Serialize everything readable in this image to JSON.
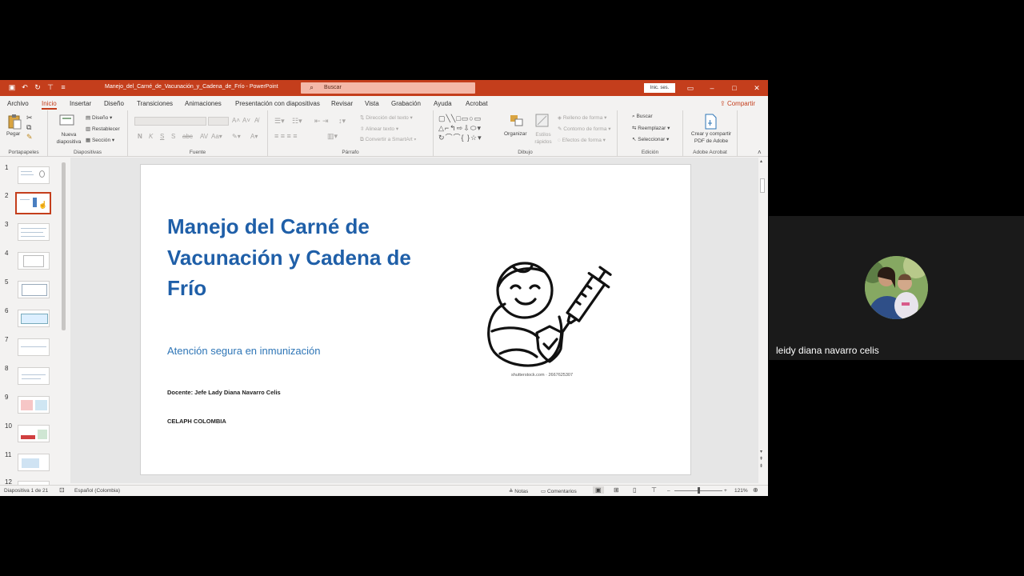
{
  "window": {
    "title": "Manejo_del_Carné_de_Vacunación_y_Cadena_de_Frío  -  PowerPoint",
    "search_placeholder": "Buscar",
    "signin_label": "Inic. ses."
  },
  "tabs": [
    {
      "label": "Archivo",
      "active": false
    },
    {
      "label": "Inicio",
      "active": true
    },
    {
      "label": "Insertar",
      "active": false
    },
    {
      "label": "Diseño",
      "active": false
    },
    {
      "label": "Transiciones",
      "active": false
    },
    {
      "label": "Animaciones",
      "active": false
    },
    {
      "label": "Presentación con diapositivas",
      "active": false
    },
    {
      "label": "Revisar",
      "active": false
    },
    {
      "label": "Vista",
      "active": false
    },
    {
      "label": "Grabación",
      "active": false
    },
    {
      "label": "Ayuda",
      "active": false
    },
    {
      "label": "Acrobat",
      "active": false
    }
  ],
  "share_label": "Compartir",
  "ribbon": {
    "portapapeles": {
      "label": "Portapapeles",
      "paste": "Pegar"
    },
    "diapositivas": {
      "label": "Diapositivas",
      "new_slide": "Nueva diapositiva",
      "layout": "Diseño",
      "reset": "Restablecer",
      "section": "Sección"
    },
    "fuente": {
      "label": "Fuente"
    },
    "parrafo": {
      "label": "Párrafo",
      "text_direction": "Dirección del texto",
      "align_text": "Alinear texto",
      "smartart": "Convertir a SmartArt"
    },
    "dibujo": {
      "label": "Dibujo",
      "arrange": "Organizar",
      "quick_styles": "Estilos rápidos",
      "shape_fill": "Relleno de forma",
      "shape_outline": "Contorno de forma",
      "shape_effects": "Efectos de forma"
    },
    "edicion": {
      "label": "Edición",
      "find": "Buscar",
      "replace": "Reemplazar",
      "select": "Seleccionar"
    },
    "acrobat": {
      "label": "Adobe Acrobat",
      "create_share": "Crear y compartir PDF de Adobe"
    }
  },
  "thumbnails": [
    "1",
    "2",
    "3",
    "4",
    "5",
    "6",
    "7",
    "8",
    "9",
    "10",
    "11",
    "12"
  ],
  "selected_slide": 2,
  "slide": {
    "title": "Manejo del Carné de Vacunación y Cadena de Frío",
    "subtitle": "Atención segura en inmunización",
    "teacher": "Docente: Jefe Lady Diana Navarro Celis",
    "organization": "CELAPH COLOMBIA",
    "image_credit": "shutterstock.com · 2667625307"
  },
  "status": {
    "slide_counter": "Diapositiva 1 de 21",
    "language": "Español (Colombia)",
    "notes": "Notas",
    "comments": "Comentarios",
    "zoom": "121%"
  },
  "participant": {
    "name": "leidy diana navarro celis"
  },
  "colors": {
    "ppt_accent": "#c43e1c",
    "title_blue": "#1f5fa8",
    "subtitle_blue": "#2e75b6"
  }
}
